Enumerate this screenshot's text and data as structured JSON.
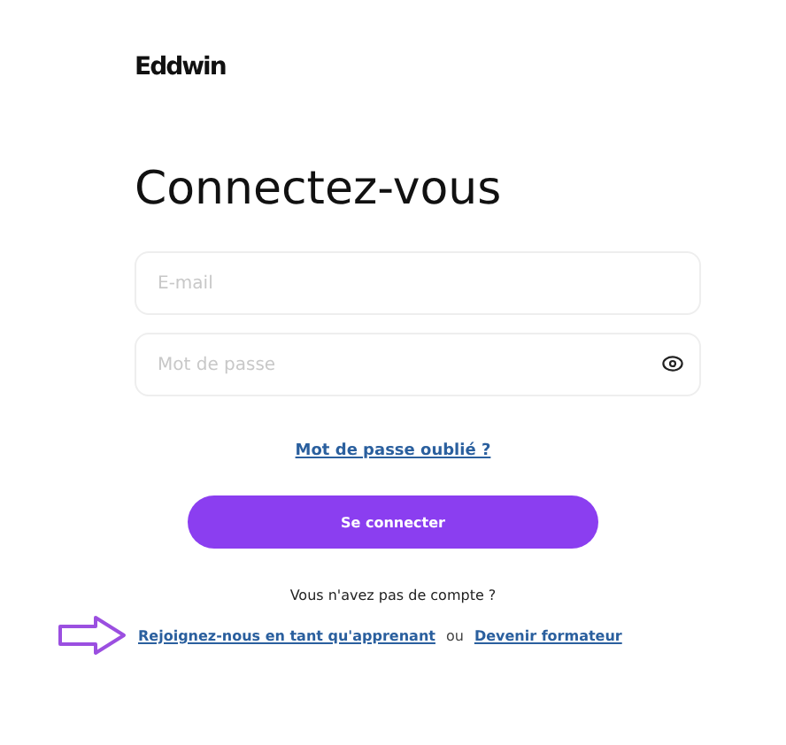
{
  "logo": "Eddwin",
  "title": "Connectez-vous",
  "email_field": {
    "placeholder": "E-mail"
  },
  "password_field": {
    "placeholder": "Mot de passe"
  },
  "forgot_link": "Mot de passe oublié ?",
  "login_button": "Se connecter",
  "no_account_text": "Vous n'avez pas de compte ?",
  "signup": {
    "learner_link": "Rejoignez-nous en tant qu'apprenant",
    "separator": "ou",
    "trainer_link": "Devenir formateur"
  }
}
